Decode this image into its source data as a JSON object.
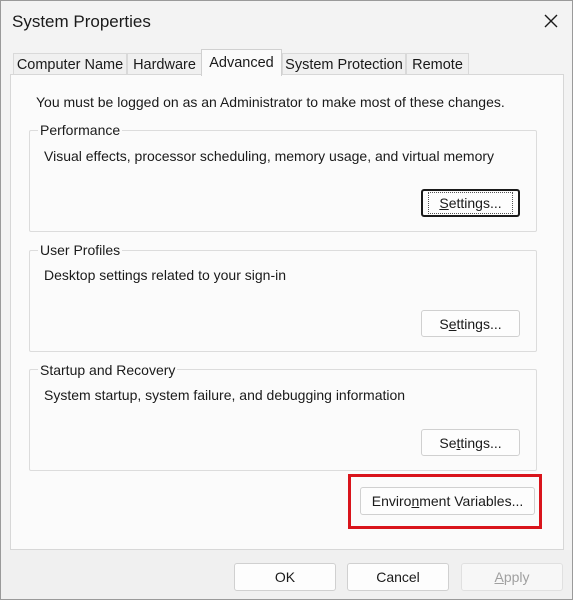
{
  "window": {
    "title": "System Properties"
  },
  "tabs": [
    {
      "label": "Computer Name"
    },
    {
      "label": "Hardware"
    },
    {
      "label": "Advanced"
    },
    {
      "label": "System Protection"
    },
    {
      "label": "Remote"
    }
  ],
  "active_tab": "Advanced",
  "note": "You must be logged on as an Administrator to make most of these changes.",
  "groups": {
    "performance": {
      "title": "Performance",
      "description": "Visual effects, processor scheduling, memory usage, and virtual memory",
      "button_mnemonic": "S",
      "button_rest": "ettings..."
    },
    "user_profiles": {
      "title": "User Profiles",
      "description": "Desktop settings related to your sign-in",
      "button_pre": "S",
      "button_mnemonic": "e",
      "button_rest": "ttings..."
    },
    "startup_recovery": {
      "title": "Startup and Recovery",
      "description": "System startup, system failure, and debugging information",
      "button_pre": "Se",
      "button_mnemonic": "t",
      "button_rest": "tings..."
    }
  },
  "env_button": {
    "pre": "Enviro",
    "mnemonic": "n",
    "rest": "ment Variables..."
  },
  "footer": {
    "ok": "OK",
    "cancel": "Cancel",
    "apply_mnemonic": "A",
    "apply_rest": "pply"
  },
  "colors": {
    "highlight": "#d9141b"
  }
}
